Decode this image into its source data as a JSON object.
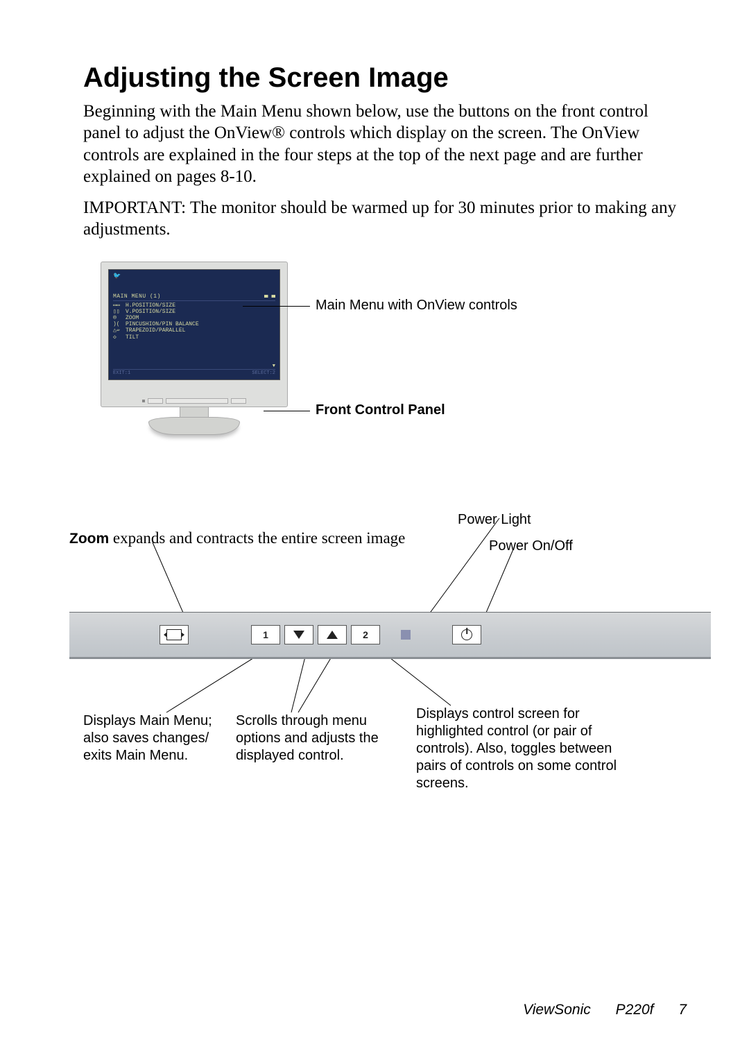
{
  "heading": "Adjusting the Screen Image",
  "intro": "Beginning with the Main Menu shown below, use the buttons on the front control panel to adjust the OnView® controls which display on the screen. The OnView controls are explained in the four steps at the top of the next page and are further explained on pages 8-10.",
  "important": "IMPORTANT: The monitor should be warmed up for 30 minutes prior to making any adjustments.",
  "osd": {
    "title": "MAIN MENU (1)",
    "items": [
      "H.POSITION/SIZE",
      "V.POSITION/SIZE",
      "ZOOM",
      "PINCUSHION/PIN BALANCE",
      "TRAPEZOID/PARALLEL",
      "TILT"
    ],
    "exit": "EXIT:1",
    "select": "SELECT:2"
  },
  "callouts": {
    "mainmenu": "Main Menu with OnView controls",
    "frontpanel": "Front Control Panel"
  },
  "panel": {
    "zoom_bold": "Zoom",
    "zoom_rest": " expands and contracts the entire screen image",
    "power_light": "Power Light",
    "power_onoff": "Power On/Off",
    "btn1_desc": "Displays Main Menu; also saves changes/ exits Main Menu.",
    "arrows_desc": "Scrolls through menu options and adjusts the displayed control.",
    "btn2_desc": "Displays control screen for highlighted control (or pair of controls). Also, toggles between pairs of controls on some control screens.",
    "label_1": "1",
    "label_2": "2"
  },
  "footer": {
    "brand": "ViewSonic",
    "model": "P220f",
    "page": "7"
  }
}
